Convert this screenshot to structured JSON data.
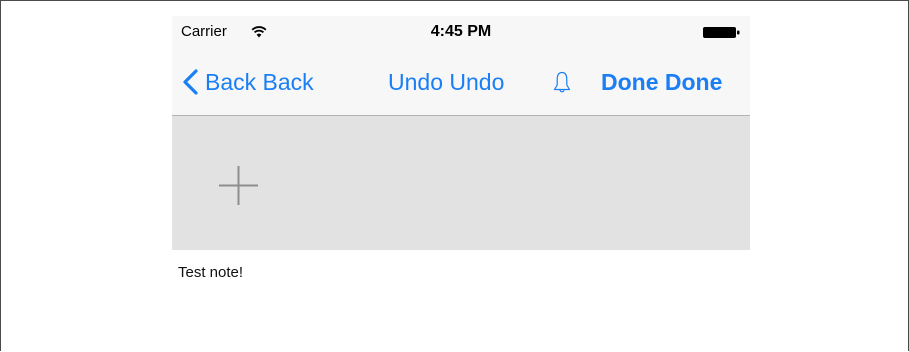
{
  "status_bar": {
    "carrier": "Carrier",
    "time": "4:45 PM",
    "wifi_icon": "wifi-icon",
    "battery_icon": "battery-icon"
  },
  "nav_bar": {
    "back_label": "Back Back",
    "undo_label": "Undo Undo",
    "done_label": "Done Done",
    "bell_icon": "bell-icon",
    "accent_color": "#1a7ef5"
  },
  "canvas": {
    "background_color": "#e2e2e2",
    "add_icon": "plus-icon"
  },
  "note": {
    "text": "Test note!"
  }
}
